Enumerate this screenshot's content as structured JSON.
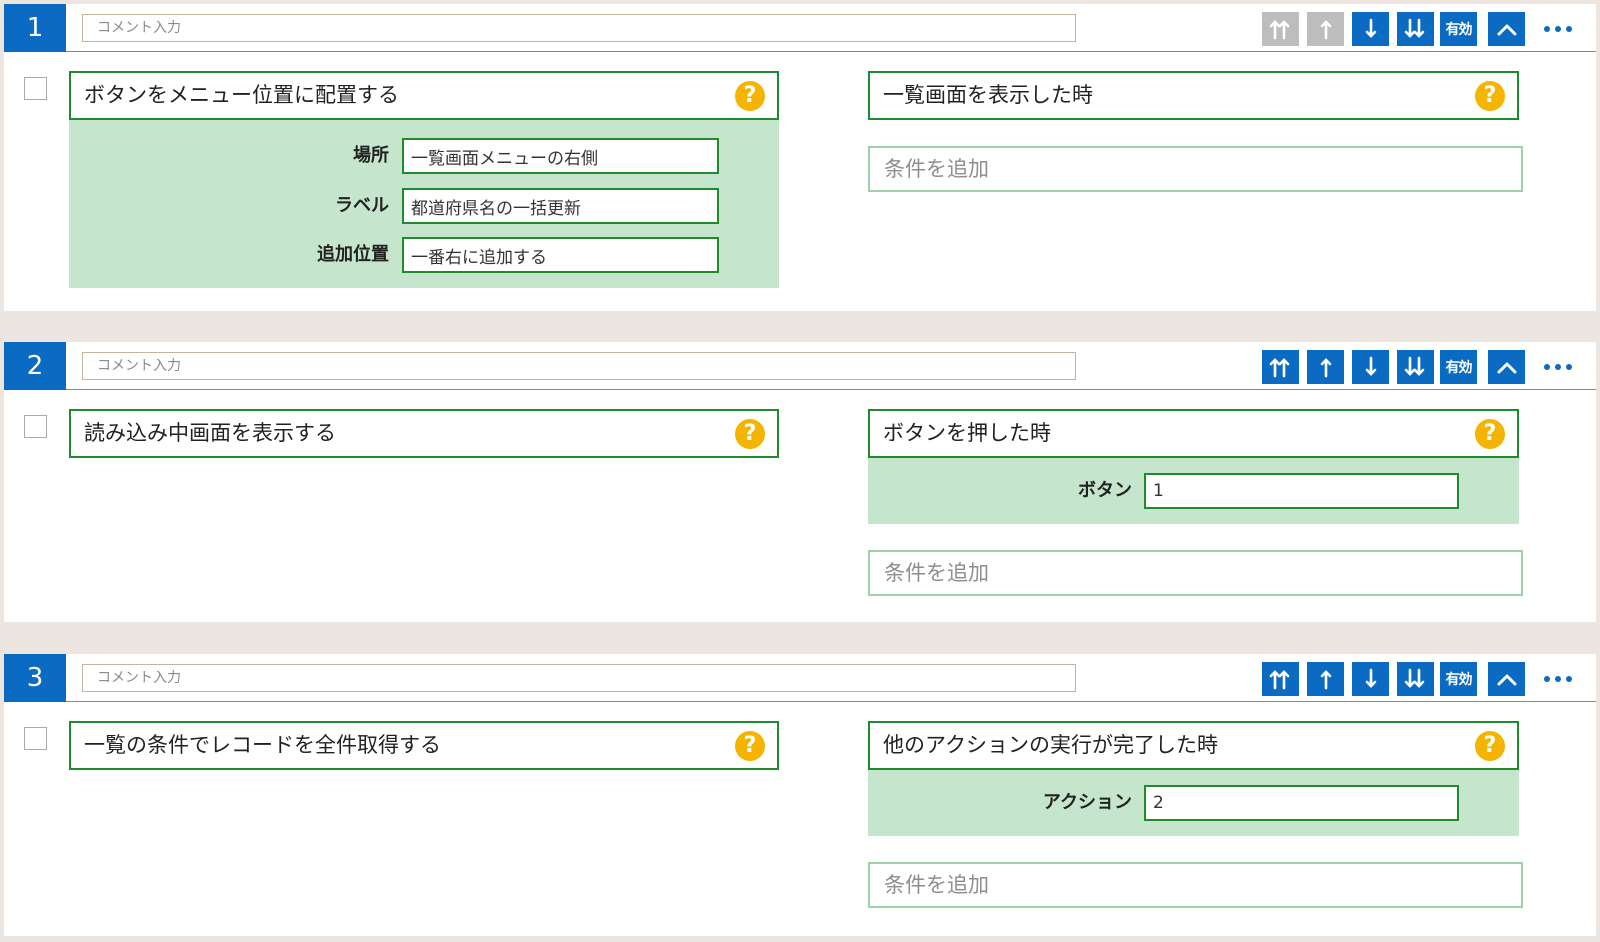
{
  "colors": {
    "background": "#ede6e0",
    "header_blue": "#0b6bc2",
    "disabled_gray": "#bdbdbd",
    "green_border": "#1e8c2c",
    "param_panel_green": "#c5e6cd",
    "help_yellow": "#f4b400"
  },
  "common": {
    "comment_placeholder": "コメント入力",
    "enable_label": "有効",
    "help_symbol": "?",
    "add_condition_label": "条件を追加",
    "icons": [
      "move-to-top-icon",
      "move-up-icon",
      "move-down-icon",
      "move-to-bottom-icon",
      "collapse-chevron-icon",
      "more-options-icon",
      "help-icon"
    ]
  },
  "rules": [
    {
      "number": "1",
      "move_top_disabled": true,
      "move_up_disabled": true,
      "action": {
        "title": "ボタンをメニュー位置に配置する",
        "params": [
          {
            "label": "場所",
            "value": "一覧画面メニューの右側"
          },
          {
            "label": "ラベル",
            "value": "都道府県名の一括更新"
          },
          {
            "label": "追加位置",
            "value": "一番右に追加する"
          }
        ]
      },
      "trigger": {
        "title": "一覧画面を表示した時",
        "params": []
      }
    },
    {
      "number": "2",
      "move_top_disabled": false,
      "move_up_disabled": false,
      "action": {
        "title": "読み込み中画面を表示する",
        "params": []
      },
      "trigger": {
        "title": "ボタンを押した時",
        "params": [
          {
            "label": "ボタン",
            "value": "1"
          }
        ]
      }
    },
    {
      "number": "3",
      "move_top_disabled": false,
      "move_up_disabled": false,
      "action": {
        "title": "一覧の条件でレコードを全件取得する",
        "params": []
      },
      "trigger": {
        "title": "他のアクションの実行が完了した時",
        "params": [
          {
            "label": "アクション",
            "value": "2"
          }
        ]
      }
    }
  ]
}
